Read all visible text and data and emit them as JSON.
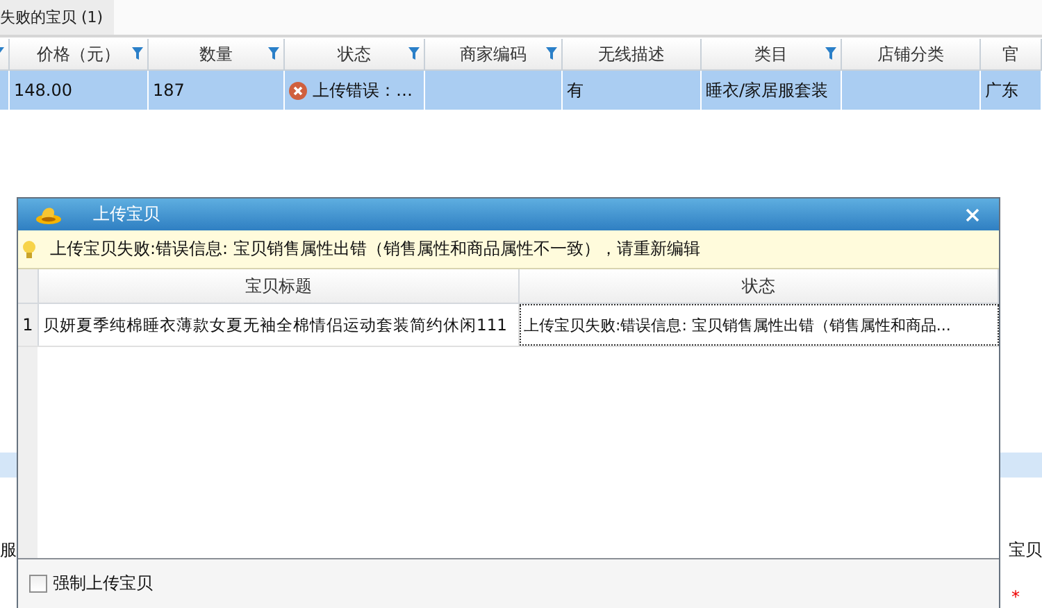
{
  "tabs": [
    {
      "label": "失败的宝贝",
      "count": "(1)",
      "selected": true
    }
  ],
  "table": {
    "columns": [
      {
        "filter": true
      },
      {
        "label": "价格（元）",
        "filter": true
      },
      {
        "label": "数量",
        "filter": true
      },
      {
        "label": "状态",
        "filter": true
      },
      {
        "label": "商家编码",
        "filter": true
      },
      {
        "label": "无线描述",
        "filter": false
      },
      {
        "label": "类目",
        "filter": true
      },
      {
        "label": "店铺分类",
        "filter": false
      },
      {
        "label": "官",
        "filter": false
      }
    ],
    "rows": [
      {
        "selected": true,
        "cells": [
          {},
          {
            "text": "148.00"
          },
          {
            "text": "187"
          },
          {
            "text": "上传错误：…",
            "kind": "error"
          },
          {},
          {
            "text": "有"
          },
          {
            "text": "睡衣/家居服套装"
          },
          {},
          {
            "text": "广东"
          }
        ]
      }
    ]
  },
  "behind": {
    "left_label": "服",
    "right_label": "宝贝",
    "required_mark": "*"
  },
  "dialog": {
    "title": "上传宝贝",
    "message": "上传宝贝失败:错误信息:  宝贝销售属性出错（销售属性和商品属性不一致），请重新编辑",
    "columns": [
      "宝贝标题",
      "状态"
    ],
    "rows": [
      {
        "number": "1",
        "title": "贝妍夏季纯棉睡衣薄款女夏无袖全棉情侣运动套装简约休闲111",
        "status": "上传宝贝失败:错误信息: 宝贝销售属性出错（销售属性和商品...",
        "status_focused": true
      }
    ],
    "force_upload": {
      "label": "强制上传宝贝",
      "checked": false
    }
  }
}
